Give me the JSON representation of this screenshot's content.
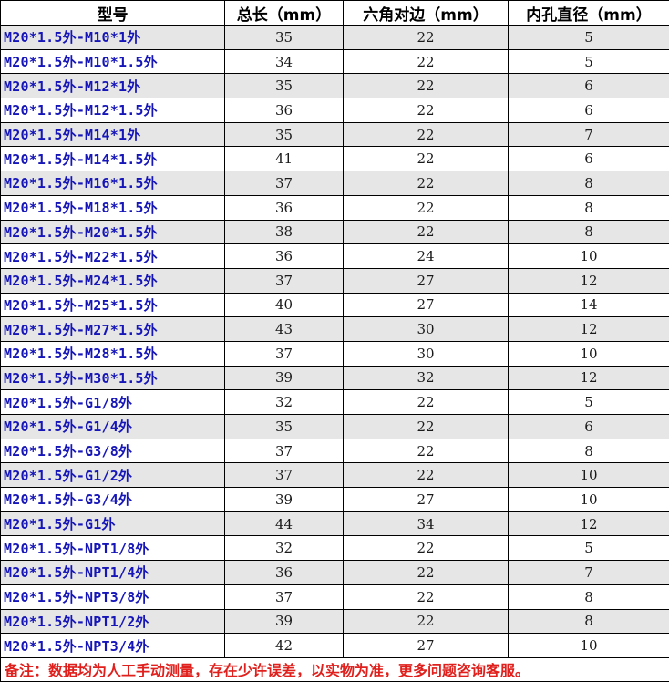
{
  "headers": [
    "型号",
    "总长（mm）",
    "六角对边（mm）",
    "内孔直径（mm）"
  ],
  "rows": [
    [
      "M20*1.5外-M10*1外",
      "35",
      "22",
      "5"
    ],
    [
      "M20*1.5外-M10*1.5外",
      "34",
      "22",
      "5"
    ],
    [
      "M20*1.5外-M12*1外",
      "35",
      "22",
      "6"
    ],
    [
      "M20*1.5外-M12*1.5外",
      "36",
      "22",
      "6"
    ],
    [
      "M20*1.5外-M14*1外",
      "35",
      "22",
      "7"
    ],
    [
      "M20*1.5外-M14*1.5外",
      "41",
      "22",
      "6"
    ],
    [
      "M20*1.5外-M16*1.5外",
      "37",
      "22",
      "8"
    ],
    [
      "M20*1.5外-M18*1.5外",
      "36",
      "22",
      "8"
    ],
    [
      "M20*1.5外-M20*1.5外",
      "38",
      "22",
      "8"
    ],
    [
      "M20*1.5外-M22*1.5外",
      "36",
      "24",
      "10"
    ],
    [
      "M20*1.5外-M24*1.5外",
      "37",
      "27",
      "12"
    ],
    [
      "M20*1.5外-M25*1.5外",
      "40",
      "27",
      "14"
    ],
    [
      "M20*1.5外-M27*1.5外",
      "43",
      "30",
      "12"
    ],
    [
      "M20*1.5外-M28*1.5外",
      "37",
      "30",
      "10"
    ],
    [
      "M20*1.5外-M30*1.5外",
      "39",
      "32",
      "12"
    ],
    [
      "M20*1.5外-G1/8外",
      "32",
      "22",
      "5"
    ],
    [
      "M20*1.5外-G1/4外",
      "35",
      "22",
      "6"
    ],
    [
      "M20*1.5外-G3/8外",
      "37",
      "22",
      "8"
    ],
    [
      "M20*1.5外-G1/2外",
      "37",
      "22",
      "10"
    ],
    [
      "M20*1.5外-G3/4外",
      "39",
      "27",
      "10"
    ],
    [
      "M20*1.5外-G1外",
      "44",
      "34",
      "12"
    ],
    [
      "M20*1.5外-NPT1/8外",
      "32",
      "22",
      "5"
    ],
    [
      "M20*1.5外-NPT1/4外",
      "36",
      "22",
      "7"
    ],
    [
      "M20*1.5外-NPT3/8外",
      "37",
      "22",
      "8"
    ],
    [
      "M20*1.5外-NPT1/2外",
      "39",
      "22",
      "8"
    ],
    [
      "M20*1.5外-NPT3/4外",
      "42",
      "27",
      "10"
    ]
  ],
  "note": "备注：数据均为人工手动测量，存在少许误差，以实物为准，更多问题咨询客服。",
  "colors": {
    "model_text": "#1515b8",
    "note_text": "#e0201c",
    "row_shade": "#e6e6e6"
  }
}
